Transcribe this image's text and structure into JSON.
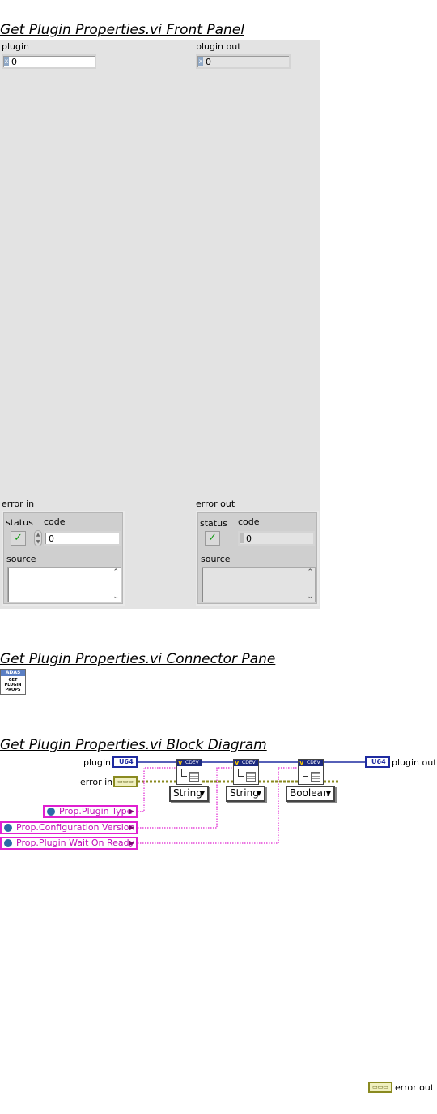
{
  "front_panel": {
    "title": "Get Plugin Properties.vi Front Panel",
    "plugin": {
      "label": "plugin",
      "radix": "x",
      "value": "0"
    },
    "plugin_out": {
      "label": "plugin out",
      "radix": "x",
      "value": "0"
    },
    "error_in": {
      "label": "error in",
      "status_label": "status",
      "code_label": "code",
      "code_value": "0",
      "source_label": "source",
      "source_value": ""
    },
    "error_out": {
      "label": "error out",
      "status_label": "status",
      "code_label": "code",
      "code_value": "0",
      "source_label": "source",
      "source_value": ""
    }
  },
  "connector_pane": {
    "title": "Get Plugin Properties.vi Connector Pane",
    "icon_header": "ADAS",
    "icon_text": "GET PLUGIN PROPS"
  },
  "block_diagram": {
    "title": "Get Plugin Properties.vi Block Diagram",
    "plugin_label": "plugin",
    "plugin_terminal": "U64",
    "error_in_label": "error in",
    "plugin_out_label": "plugin out",
    "plugin_out_terminal": "U64",
    "error_out_label": "error out",
    "node_header": "CDEV",
    "constants": [
      "Prop.Plugin Type",
      "Prop.Configuration Version",
      "Prop.Plugin Wait On Ready"
    ],
    "types": [
      "String",
      "String",
      "Boolean"
    ],
    "wire_colors": {
      "cluster": "#e020d0",
      "u64": "#1f2ba0",
      "error": "#8a8a20"
    }
  }
}
